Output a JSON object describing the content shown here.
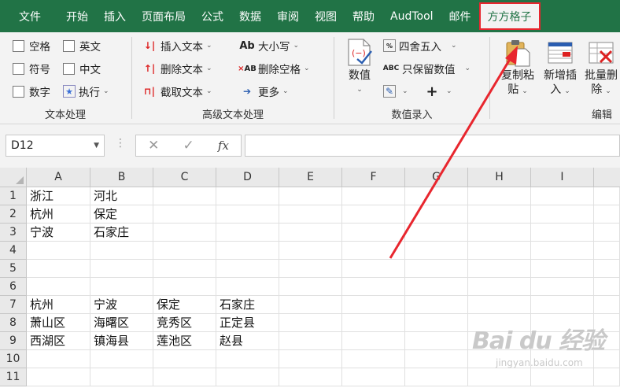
{
  "tabs": [
    "文件",
    "开始",
    "插入",
    "页面布局",
    "公式",
    "数据",
    "审阅",
    "视图",
    "帮助",
    "AudTool",
    "邮件",
    "方方格子"
  ],
  "active_tab": "方方格子",
  "ribbon": {
    "text_group": {
      "label": "文本处理",
      "checks": [
        "空格",
        "英文",
        "符号",
        "中文",
        "数字"
      ],
      "exec_label": "执行"
    },
    "adv_group": {
      "label": "高级文本处理",
      "buttons": [
        "插入文本",
        "删除文本",
        "截取文本",
        "大小写",
        "删除空格",
        "更多"
      ]
    },
    "num_group": {
      "label": "数值录入",
      "value_btn": "数值",
      "round_btn": "四舍五入",
      "keep_btn": "只保留数值"
    },
    "edit_group": {
      "label": "编辑",
      "copy_line1": "复制粘",
      "copy_line2": "贴",
      "add_line1": "新增插",
      "add_line2": "入",
      "del_line1": "批量删",
      "del_line2": "除"
    }
  },
  "formula_bar": {
    "name_box": "D12",
    "fx": "fx",
    "content": ""
  },
  "grid": {
    "columns": [
      "A",
      "B",
      "C",
      "D",
      "E",
      "F",
      "G",
      "H",
      "I"
    ],
    "rows": [
      "1",
      "2",
      "3",
      "4",
      "5",
      "6",
      "7",
      "8",
      "9",
      "10",
      "11"
    ],
    "cells": {
      "r1": [
        "浙江",
        "河北",
        "",
        ""
      ],
      "r2": [
        "杭州",
        "保定",
        "",
        ""
      ],
      "r3": [
        "宁波",
        "石家庄",
        "",
        ""
      ],
      "r4": [
        "",
        "",
        "",
        ""
      ],
      "r5": [
        "",
        "",
        "",
        ""
      ],
      "r6": [
        "",
        "",
        "",
        ""
      ],
      "r7": [
        "杭州",
        "宁波",
        "保定",
        "石家庄"
      ],
      "r8": [
        "萧山区",
        "海曙区",
        "竞秀区",
        "正定县"
      ],
      "r9": [
        "西湖区",
        "镇海县",
        "莲池区",
        "赵县"
      ]
    }
  },
  "watermark": {
    "logo": "Bai du 经验",
    "url": "jingyan.baidu.com"
  },
  "colors": {
    "excel_green": "#217346",
    "highlight_red": "#e8262e"
  }
}
